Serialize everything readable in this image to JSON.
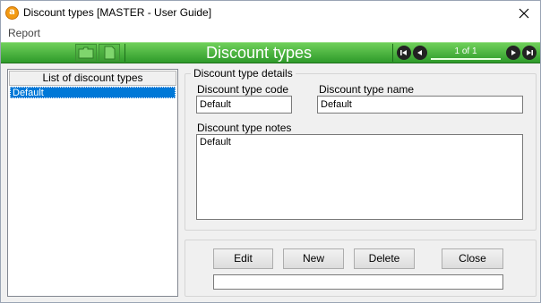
{
  "window": {
    "title": "Discount types [MASTER - User Guide]",
    "app_icon_letter": "a"
  },
  "menu": {
    "items": [
      {
        "label": "Report"
      }
    ]
  },
  "toolbar": {
    "title": "Discount types",
    "record_counter": "1 of 1",
    "colors": {
      "accent": "#3aa534",
      "text": "#ffffff"
    }
  },
  "list": {
    "header": "List of discount types",
    "items": [
      {
        "label": "Default",
        "selected": true
      }
    ]
  },
  "details": {
    "group_label": "Discount type details",
    "code_label": "Discount type code",
    "code_value": "Default",
    "name_label": "Discount type name",
    "name_value": "Default",
    "notes_label": "Discount type notes",
    "notes_value": "Default"
  },
  "actions": {
    "edit_label": "Edit",
    "new_label": "New",
    "delete_label": "Delete",
    "close_label": "Close",
    "status_value": ""
  },
  "icons": {
    "close": "close-icon",
    "folder": "folder-icon",
    "document": "document-icon",
    "first": "first-record-icon",
    "previous": "previous-record-icon",
    "next": "next-record-icon",
    "last": "last-record-icon"
  }
}
